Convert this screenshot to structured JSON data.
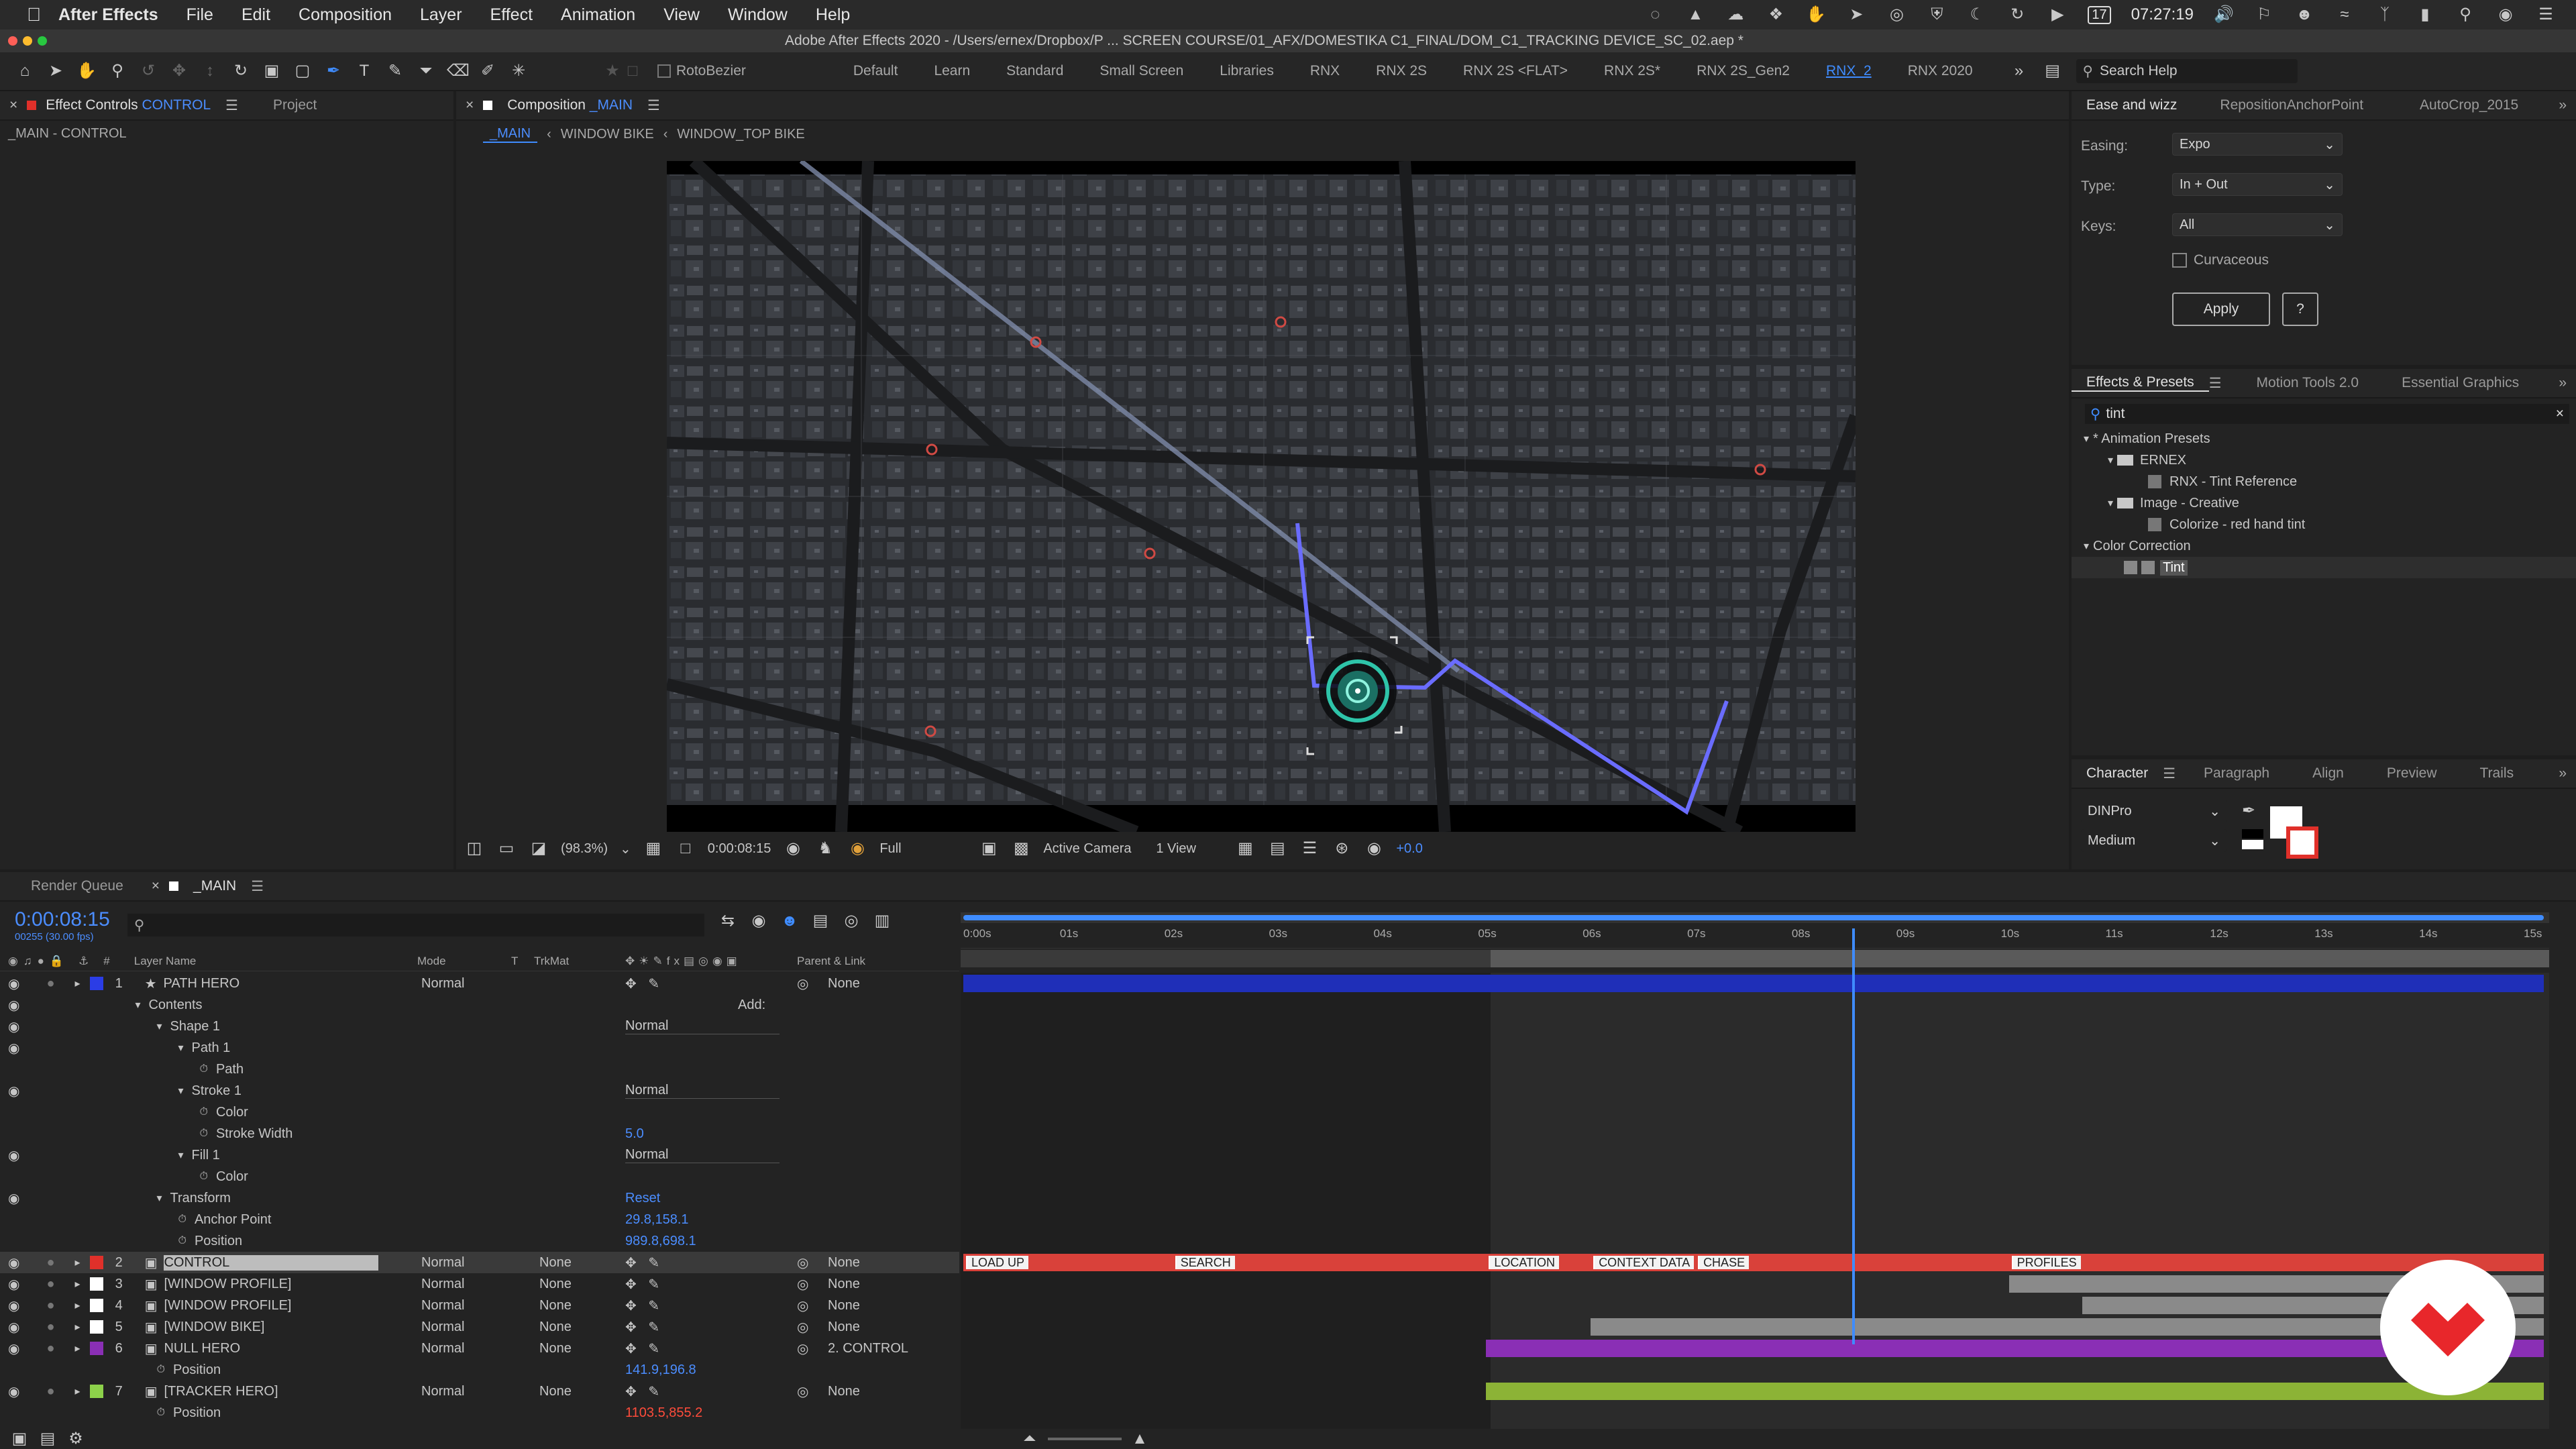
{
  "menubar": {
    "app": "After Effects",
    "items": [
      "File",
      "Edit",
      "Composition",
      "Layer",
      "Effect",
      "Animation",
      "View",
      "Window",
      "Help"
    ],
    "clock": "07:27:19",
    "calendar": "17"
  },
  "titlebar": {
    "text": "Adobe After Effects 2020 - /Users/ernex/Dropbox/P ... SCREEN COURSE/01_AFX/DOMESTIKA C1_FINAL/DOM_C1_TRACKING DEVICE_SC_02.aep *"
  },
  "toolbar": {
    "rotobezier": "RotoBezier",
    "workspaces": [
      "Default",
      "Learn",
      "Standard",
      "Small Screen",
      "Libraries",
      "RNX",
      "RNX 2S",
      "RNX 2S <FLAT>",
      "RNX 2S*",
      "RNX 2S_Gen2",
      "RNX_2",
      "RNX 2020"
    ],
    "active_workspace": "RNX_2",
    "search_placeholder": "Search Help"
  },
  "left_panel": {
    "tab_effect": "Effect Controls",
    "tab_effect_target": "CONTROL",
    "tab_project": "Project",
    "subtitle": "_MAIN - CONTROL"
  },
  "comp_panel": {
    "tab": "Composition",
    "tab_target": "_MAIN",
    "breadcrumbs": [
      "_MAIN",
      "WINDOW BIKE",
      "WINDOW_TOP BIKE"
    ],
    "zoom": "(98.3%)",
    "timecode": "0:00:08:15",
    "resolution": "Full",
    "camera": "Active Camera",
    "views": "1 View",
    "exposure": "+0.0"
  },
  "ease_panel": {
    "tabs": [
      "Ease and wizz",
      "RepositionAnchorPoint",
      "AutoCrop_2015"
    ],
    "easing_label": "Easing:",
    "easing_value": "Expo",
    "type_label": "Type:",
    "type_value": "In + Out",
    "keys_label": "Keys:",
    "keys_value": "All",
    "curvaceous": "Curvaceous",
    "apply": "Apply",
    "help": "?"
  },
  "effects_panel": {
    "tabs": [
      "Effects & Presets",
      "Motion Tools 2.0",
      "Essential Graphics"
    ],
    "search_value": "tint",
    "tree": [
      {
        "label": "* Animation Presets",
        "level": 0,
        "type": "group"
      },
      {
        "label": "ERNEX",
        "level": 1,
        "type": "folder"
      },
      {
        "label": "RNX - Tint Reference",
        "level": 2,
        "type": "item"
      },
      {
        "label": "Image - Creative",
        "level": 1,
        "type": "folder"
      },
      {
        "label": "Colorize - red hand tint",
        "level": 2,
        "type": "item"
      },
      {
        "label": "Color Correction",
        "level": 0,
        "type": "group"
      },
      {
        "label": "Tint",
        "level": 1,
        "type": "effect"
      }
    ]
  },
  "character_panel": {
    "tabs": [
      "Character",
      "Paragraph",
      "Align",
      "Preview",
      "Trails"
    ],
    "font": "DINPro",
    "style": "Medium"
  },
  "timeline": {
    "tabs": [
      "Render Queue",
      "_MAIN"
    ],
    "timecode": "0:00:08:15",
    "fps_info": "00255 (30.00 fps)",
    "headers": {
      "layer_name": "Layer Name",
      "mode": "Mode",
      "t": "T",
      "trkmat": "TrkMat",
      "parent": "Parent & Link"
    },
    "ruler": [
      "0:00s",
      "01s",
      "02s",
      "03s",
      "04s",
      "05s",
      "06s",
      "07s",
      "08s",
      "09s",
      "10s",
      "11s",
      "12s",
      "13s",
      "14s",
      "15s"
    ],
    "playhead_seconds": 8.5,
    "markers": [
      "LOAD UP",
      "SEARCH",
      "LOCATION",
      "CONTEXT DATA",
      "CHASE",
      "PROFILES"
    ],
    "rows": [
      {
        "num": "1",
        "name": "PATH HERO",
        "mode": "Normal",
        "trkmat": "",
        "parent": "None",
        "color": "#2b3de6",
        "kind": "layer",
        "star": true
      },
      {
        "name": "Contents",
        "kind": "group",
        "indent": 1,
        "extra": "Add:"
      },
      {
        "name": "Shape 1",
        "kind": "group",
        "indent": 2,
        "value": "Normal"
      },
      {
        "name": "Path 1",
        "kind": "group",
        "indent": 3
      },
      {
        "name": "Path",
        "kind": "prop",
        "indent": 4
      },
      {
        "name": "Stroke 1",
        "kind": "group",
        "indent": 3,
        "value": "Normal"
      },
      {
        "name": "Color",
        "kind": "prop",
        "indent": 4
      },
      {
        "name": "Stroke Width",
        "kind": "prop",
        "indent": 4,
        "value": "5.0"
      },
      {
        "name": "Fill 1",
        "kind": "group",
        "indent": 3,
        "value": "Normal"
      },
      {
        "name": "Color",
        "kind": "prop",
        "indent": 4
      },
      {
        "name": "Transform",
        "kind": "group",
        "indent": 2,
        "value": "Reset"
      },
      {
        "name": "Anchor Point",
        "kind": "prop",
        "indent": 3,
        "value": "29.8,158.1"
      },
      {
        "name": "Position",
        "kind": "prop",
        "indent": 3,
        "value": "989.8,698.1"
      },
      {
        "num": "2",
        "name": "CONTROL",
        "mode": "Normal",
        "trkmat": "None",
        "parent": "None",
        "color": "#e0302a",
        "kind": "layer",
        "selected": true
      },
      {
        "num": "3",
        "name": "[WINDOW PROFILE]",
        "mode": "Normal",
        "trkmat": "None",
        "parent": "None",
        "color": "#ffffff",
        "kind": "layer"
      },
      {
        "num": "4",
        "name": "[WINDOW PROFILE]",
        "mode": "Normal",
        "trkmat": "None",
        "parent": "None",
        "color": "#ffffff",
        "kind": "layer"
      },
      {
        "num": "5",
        "name": "[WINDOW BIKE]",
        "mode": "Normal",
        "trkmat": "None",
        "parent": "None",
        "color": "#ffffff",
        "kind": "layer"
      },
      {
        "num": "6",
        "name": "NULL HERO",
        "mode": "Normal",
        "trkmat": "None",
        "parent": "2. CONTROL",
        "color": "#8a2fb5",
        "kind": "layer"
      },
      {
        "name": "Position",
        "kind": "prop",
        "indent": 2,
        "value": "141.9,196.8"
      },
      {
        "num": "7",
        "name": "[TRACKER HERO]",
        "mode": "Normal",
        "trkmat": "None",
        "parent": "None",
        "color": "#8cd14a",
        "kind": "layer"
      },
      {
        "name": "Position",
        "kind": "prop",
        "indent": 2,
        "value": "1103.5,855.2",
        "red": true
      }
    ]
  },
  "colors": {
    "accent": "#3f8cff",
    "path": "#6a6cff",
    "control_bar": "#d9413a",
    "purple_bar": "#8a2fb5",
    "green_bar": "#8cb336",
    "blue_bar": "#1f2fb8"
  }
}
